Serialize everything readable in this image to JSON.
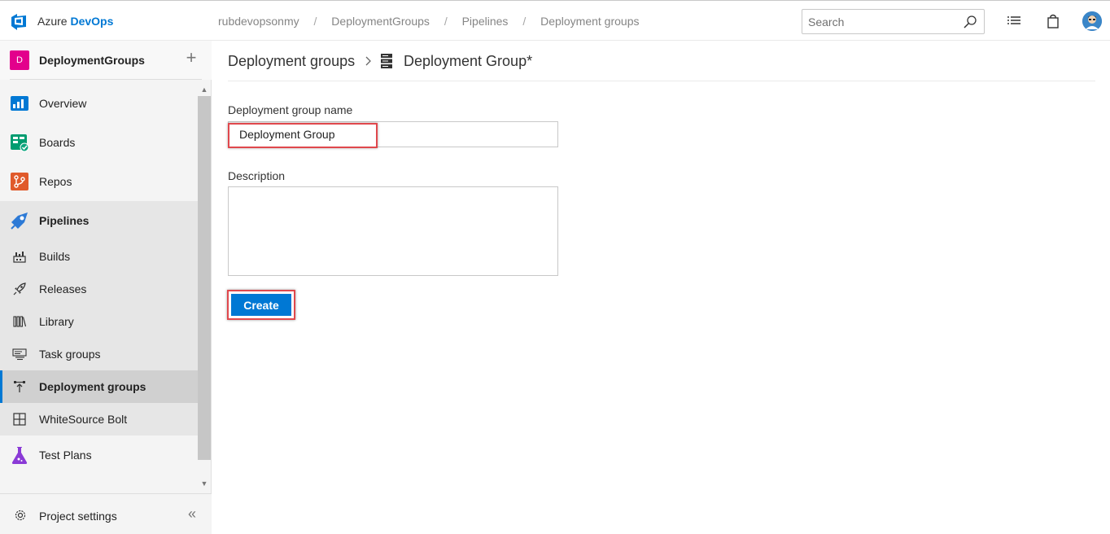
{
  "topbar": {
    "brand_prefix": "Azure",
    "brand_name": "DevOps",
    "breadcrumb": [
      "rubdevopsonmy",
      "DeploymentGroups",
      "Pipelines",
      "Deployment groups"
    ],
    "breadcrumb_separator": "/",
    "search_placeholder": "Search",
    "icons": [
      "azure-devops-logo-icon",
      "search-icon",
      "task-list-icon",
      "shopping-bag-icon",
      "user-avatar-icon"
    ]
  },
  "sidebar": {
    "project_initial": "D",
    "project_name": "DeploymentGroups",
    "add_label": "+",
    "items": [
      {
        "label": "Overview",
        "icon": "overview-icon",
        "color": "#0078d4"
      },
      {
        "label": "Boards",
        "icon": "boards-icon",
        "color": "#009c70"
      },
      {
        "label": "Repos",
        "icon": "repos-icon",
        "color": "#e05a2b"
      },
      {
        "label": "Pipelines",
        "icon": "pipelines-icon",
        "color": "#2d7ad6"
      },
      {
        "label": "Builds",
        "icon": "builds-icon"
      },
      {
        "label": "Releases",
        "icon": "releases-icon"
      },
      {
        "label": "Library",
        "icon": "library-icon"
      },
      {
        "label": "Task groups",
        "icon": "task-groups-icon"
      },
      {
        "label": "Deployment groups",
        "icon": "deployment-groups-icon",
        "selected": true
      },
      {
        "label": "WhiteSource Bolt",
        "icon": "whitesource-bolt-icon"
      },
      {
        "label": "Test Plans",
        "icon": "test-plans-icon",
        "color": "#8a3ad6"
      }
    ],
    "settings_label": "Project settings",
    "collapse_glyph": "«"
  },
  "main": {
    "breadcrumb_root": "Deployment groups",
    "title": "Deployment Group*",
    "name_label": "Deployment group name",
    "name_value": "Deployment Group",
    "description_label": "Description",
    "description_value": "",
    "create_label": "Create"
  },
  "colors": {
    "accent": "#0078d4",
    "highlight": "#e0484d",
    "project_badge": "#e3008c"
  }
}
